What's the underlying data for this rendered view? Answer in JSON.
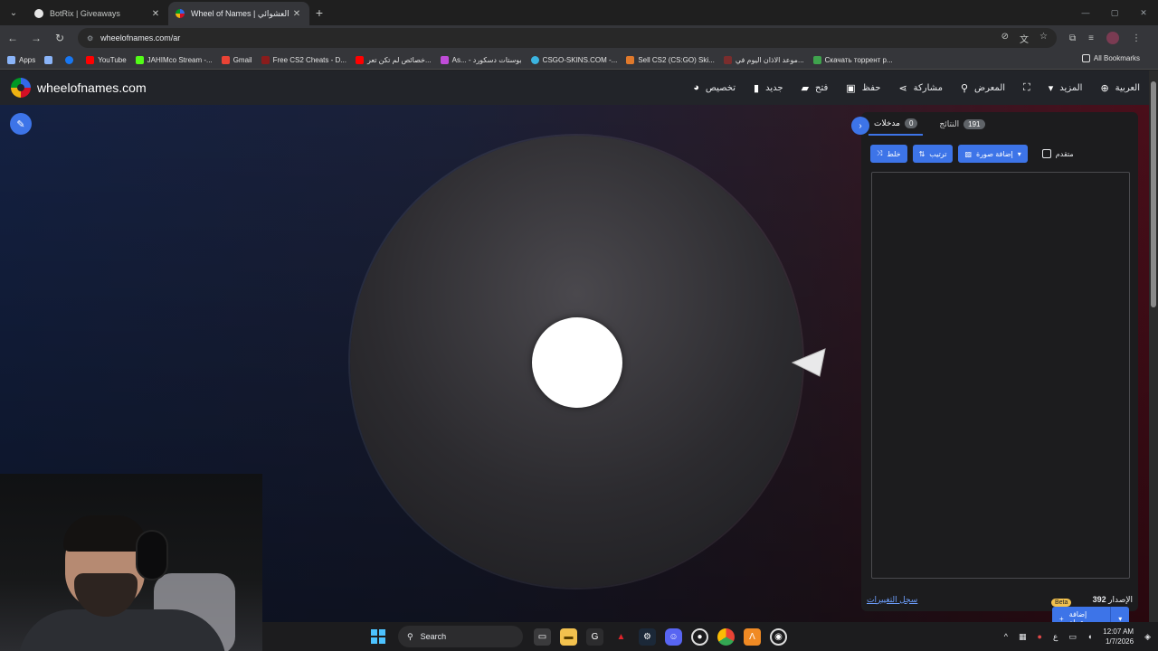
{
  "browser": {
    "tabs": [
      {
        "title": "BotRix | Giveaways",
        "active": false
      },
      {
        "title": "Wheel of Names | اسم العشوائي",
        "active": true
      }
    ],
    "url": "wheelofnames.com/ar",
    "bookmarks": [
      {
        "label": "Apps",
        "color": "#8ab4f8"
      },
      {
        "label": "",
        "color": "#8ab4f8"
      },
      {
        "label": "",
        "color": "#1877f2"
      },
      {
        "label": "YouTube",
        "color": "#ff0000"
      },
      {
        "label": "JAHIMco Stream -...",
        "color": "#53fc18"
      },
      {
        "label": "Gmail",
        "color": "#ea4335"
      },
      {
        "label": "Free CS2 Cheats - D...",
        "color": "#8a1c1c"
      },
      {
        "label": "خصائص لم تكن تعر...",
        "color": "#ff0000"
      },
      {
        "label": "As... - بوستات دسكورد",
        "color": "#c04cd8"
      },
      {
        "label": "CSGO-SKINS.COM -...",
        "color": "#3bb4e0"
      },
      {
        "label": "Sell CS2 (CS:GO) Ski...",
        "color": "#e0792b"
      },
      {
        "label": "موعد الاذان اليوم في...",
        "color": "#7a2d2d"
      },
      {
        "label": "Скачать торрент р...",
        "color": "#3fa34d"
      }
    ],
    "all_bookmarks": "All Bookmarks"
  },
  "site": {
    "name": "wheelofnames.com",
    "nav": [
      {
        "label": "تخصيص",
        "icon": "palette-icon"
      },
      {
        "label": "جديد",
        "icon": "file-icon"
      },
      {
        "label": "فتح",
        "icon": "folder-icon"
      },
      {
        "label": "حفظ",
        "icon": "save-icon"
      },
      {
        "label": "مشاركة",
        "icon": "share-icon"
      },
      {
        "label": "المعرض",
        "icon": "search-icon"
      },
      {
        "label": "",
        "icon": "fullscreen-icon"
      },
      {
        "label": "المزيد",
        "icon": "dropdown-icon"
      },
      {
        "label": "العربية",
        "icon": "globe-icon"
      }
    ]
  },
  "panel": {
    "tab_entries": {
      "label": "مدخلات",
      "count": "0"
    },
    "tab_results": {
      "label": "النتائج",
      "count": "191"
    },
    "shuffle": "خلط",
    "sort": "ترتيب",
    "add_image": "إضافة صورة",
    "advanced": "متقدم",
    "add_wheel": "إضافة عجلة",
    "beta": "Beta",
    "version_label": "الإصدار",
    "version": "392",
    "changelog": "سجل التغييرات"
  },
  "taskbar": {
    "search_placeholder": "Search",
    "lang": "ع",
    "time": "12:07 AM",
    "date": "1/7/2026"
  },
  "colors": {
    "accent": "#3d74e8"
  }
}
